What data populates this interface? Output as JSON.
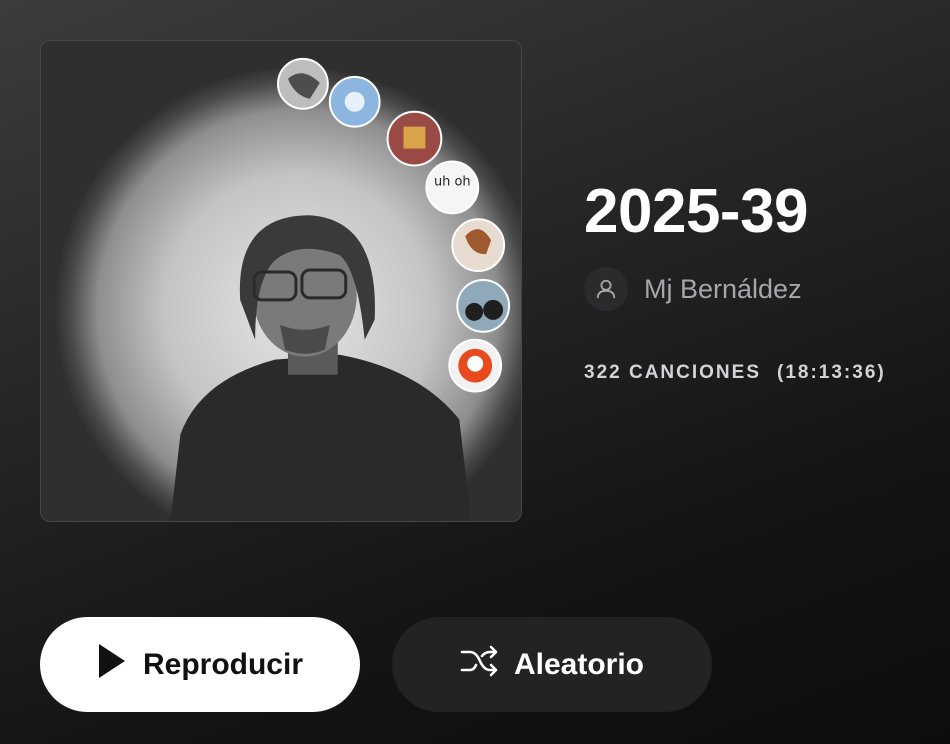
{
  "playlist": {
    "title": "2025-39",
    "owner": "Mj Bernáldez",
    "songs": "322 CANCIONES",
    "duration": "(18:13:36)"
  },
  "cover": {
    "badge_text": "uh oh"
  },
  "actions": {
    "play_label": "Reproducir",
    "shuffle_label": "Aleatorio"
  },
  "icons": {
    "owner": "person-icon",
    "play": "play-icon",
    "shuffle": "shuffle-icon"
  },
  "colors": {
    "play_button_bg": "#ffffff",
    "shuffle_button_bg": "#232323",
    "owner_text": "#a6a6ab"
  }
}
